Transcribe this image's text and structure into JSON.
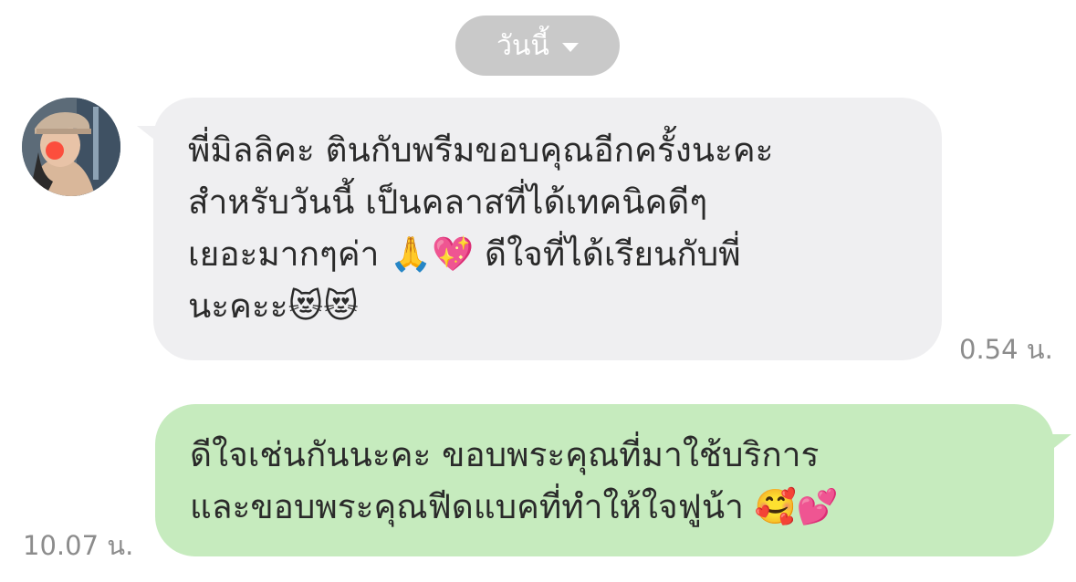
{
  "date_chip": {
    "label": "วันนี้",
    "icon": "chevron-down-icon"
  },
  "colors": {
    "incoming_bubble": "#efeff1",
    "outgoing_bubble": "#c6ebbe",
    "date_chip_bg": "#c9c9c9",
    "timestamp": "#8c8c8c"
  },
  "messages": [
    {
      "direction": "incoming",
      "avatar": "sender-avatar",
      "lines": [
        "พี่มิลลิคะ ตินกับพรีมขอบคุณอีกครั้งนะคะ",
        "สำหรับวันนี้ เป็นคลาสที่ได้เทคนิคดีๆ",
        "เยอะมากๆค่า 🙏💖 ดีใจที่ได้เรียนกับพี่",
        "นะคะะ😻😻"
      ],
      "time": "0.54 น."
    },
    {
      "direction": "outgoing",
      "lines": [
        "ดีใจเช่นกันนะคะ ขอบพระคุณที่มาใช้บริการ",
        "และขอบพระคุณฟีดแบคที่ทำให้ใจฟูน้า 🥰💕"
      ],
      "time": "10.07 น."
    }
  ]
}
